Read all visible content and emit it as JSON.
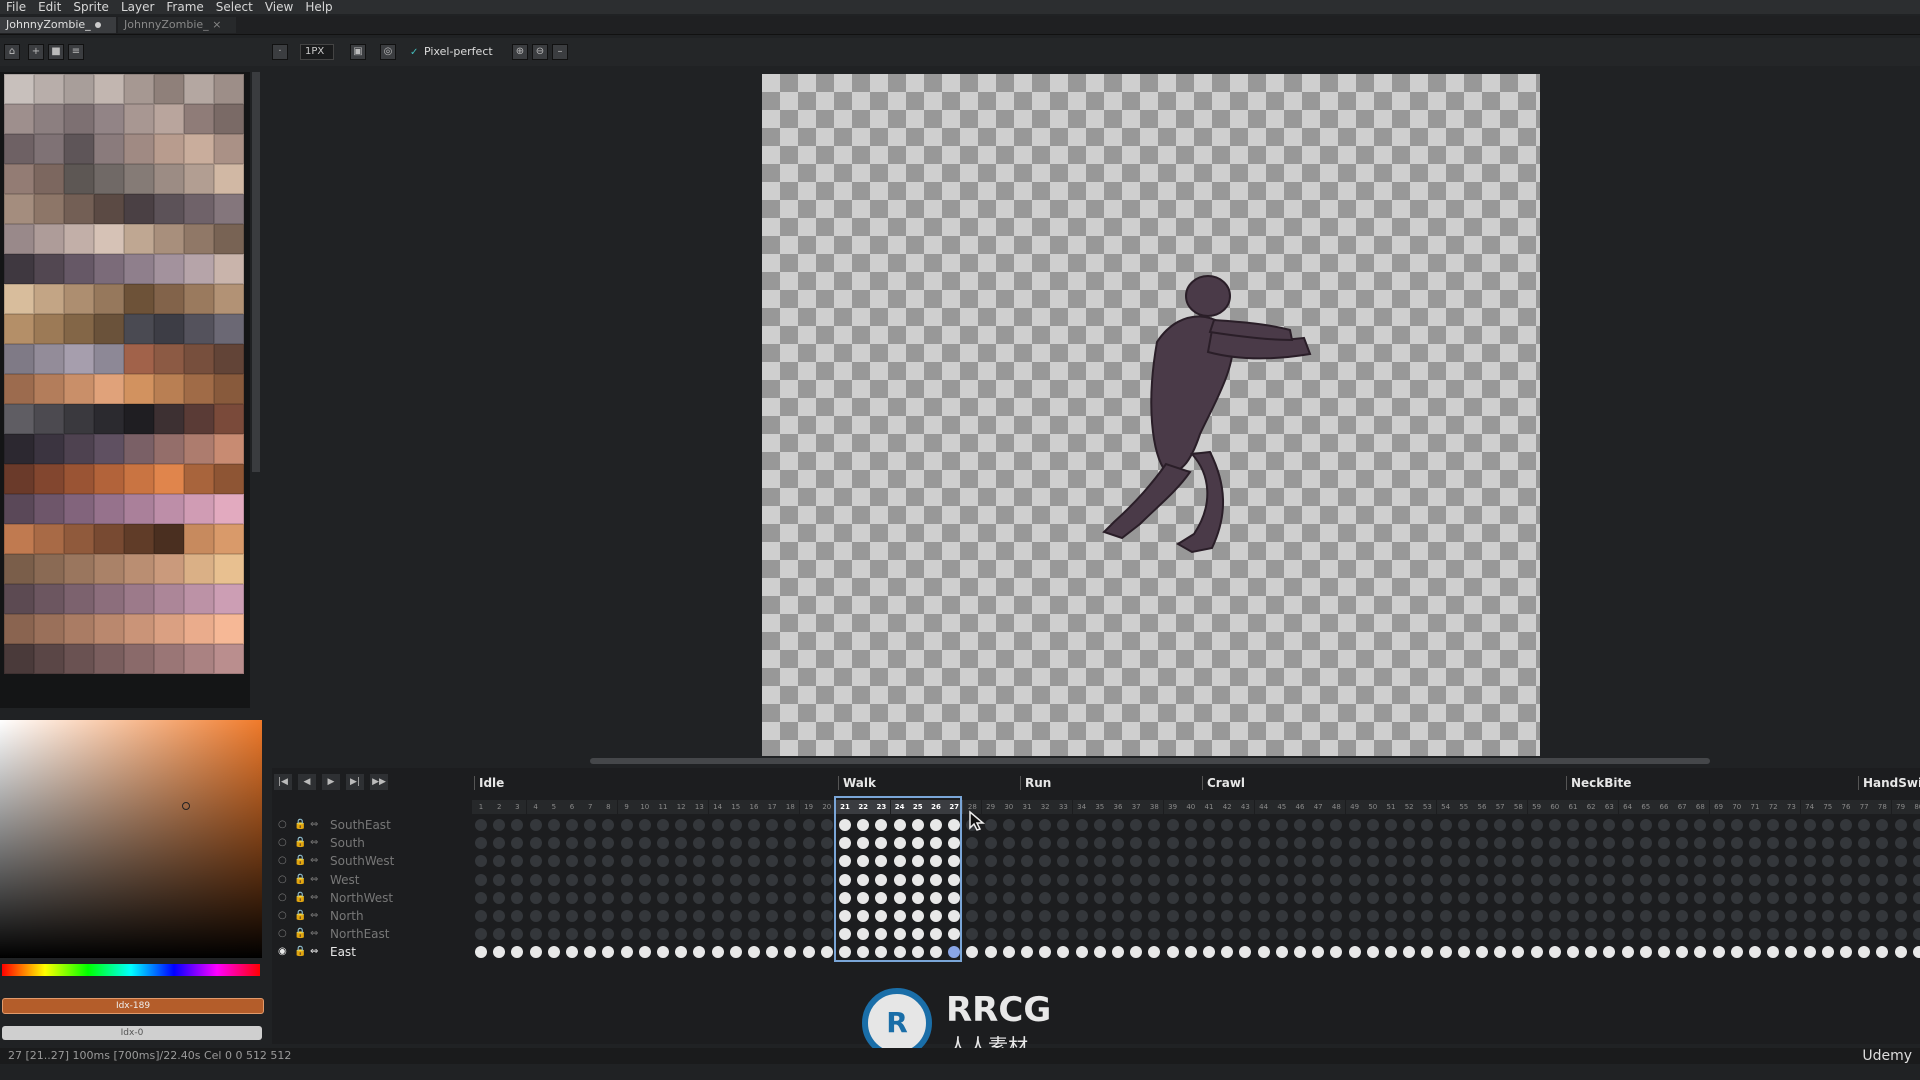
{
  "menu": [
    "File",
    "Edit",
    "Sprite",
    "Layer",
    "Frame",
    "Select",
    "View",
    "Help"
  ],
  "tabs": [
    {
      "label": "JohnnyZombie_",
      "modified": true
    },
    {
      "label": "JohnnyZombie_",
      "closable": true
    }
  ],
  "toolbar": {
    "brush_size": "1PX",
    "pixel_perfect_label": "Pixel-perfect",
    "pixel_perfect_checked": true
  },
  "palette_colors": [
    "#c8c0bc",
    "#b8aeaa",
    "#a89e9a",
    "#c2b6b0",
    "#a69892",
    "#8f807a",
    "#b4a7a1",
    "#9d8e88",
    "#9e8f8d",
    "#8c7f80",
    "#7d7072",
    "#928486",
    "#a89792",
    "#b9a59d",
    "#8f7c78",
    "#7a6a66",
    "#6e6164",
    "#7f7275",
    "#5e5558",
    "#8a7b7c",
    "#a08a83",
    "#b89c8e",
    "#c9ad9c",
    "#aa9186",
    "#937c74",
    "#7c675f",
    "#5d5754",
    "#706966",
    "#857b76",
    "#9c8c84",
    "#b29e92",
    "#d1b8a4",
    "#a48d7e",
    "#8d7668",
    "#735f55",
    "#5b4a44",
    "#4a4044",
    "#5c5258",
    "#6f6269",
    "#84767c",
    "#99898a",
    "#ae9c99",
    "#c2afa8",
    "#d6c2b6",
    "#bfa792",
    "#a88f7c",
    "#907867",
    "#786354",
    "#3f3840",
    "#524751",
    "#665866",
    "#7b6b79",
    "#8f7f8c",
    "#a3929d",
    "#b6a4a9",
    "#c9b4ab",
    "#d8bd9c",
    "#c3a585",
    "#ad8e70",
    "#96785c",
    "#6d5238",
    "#82634a",
    "#9a7a5e",
    "#b29275",
    "#b48f68",
    "#9c7a56",
    "#836647",
    "#6a523a",
    "#4a4a52",
    "#3d3d45",
    "#54525c",
    "#6b6874",
    "#7f7a86",
    "#938c99",
    "#a69ead",
    "#8d8896",
    "#a1624a",
    "#8c5a44",
    "#774f3d",
    "#624437",
    "#9c6b4e",
    "#b37d5b",
    "#c98f69",
    "#e0a27a",
    "#d2925f",
    "#b97f53",
    "#a06b47",
    "#885a3c",
    "#5f5d63",
    "#4c4a50",
    "#3a393e",
    "#2b2a2f",
    "#1f1e22",
    "#3d3032",
    "#5a3b36",
    "#7a4a3a",
    "#2c2830",
    "#3b3440",
    "#4e4250",
    "#5f5061",
    "#7a6066",
    "#946e6a",
    "#ad7c6e",
    "#c88b72",
    "#6a3a2a",
    "#82462f",
    "#9a5434",
    "#b2633a",
    "#c97442",
    "#e0854c",
    "#a8643c",
    "#8e5534",
    "#5a4858",
    "#6e566a",
    "#82647c",
    "#96728c",
    "#aa809a",
    "#bd8ea8",
    "#d09cb4",
    "#e2aabf",
    "#c07a50",
    "#a86a46",
    "#905a3c",
    "#784a32",
    "#603c28",
    "#4a2f20",
    "#c78a5e",
    "#d99a6a",
    "#7a5e4a",
    "#8a6a54",
    "#9a765e",
    "#aa8268",
    "#ba8e72",
    "#ca9a7c",
    "#dab086",
    "#e8c090",
    "#5c4a52",
    "#6c5660",
    "#7c626e",
    "#8c6e7c",
    "#9c7a8a",
    "#ac8698",
    "#bc92a6",
    "#cc9eb4",
    "#8a6450",
    "#9a705a",
    "#aa7c64",
    "#ba886e",
    "#ca9478",
    "#daa082",
    "#eaac8c",
    "#f6b896",
    "#4a3a3a",
    "#5a4646",
    "#6a5252",
    "#7a5e5e",
    "#8a6a6a",
    "#9a7676",
    "#aa8282",
    "#ba8e8e"
  ],
  "color_index_label": "Idx-189",
  "alpha_index_label": "Idx-0",
  "timeline": {
    "tags": [
      {
        "label": "Idle"
      },
      {
        "label": "Walk"
      },
      {
        "label": "Run"
      },
      {
        "label": "Crawl"
      },
      {
        "label": "NeckBite"
      },
      {
        "label": "HandSwin"
      }
    ],
    "frame_count": 80,
    "selected_range": [
      21,
      27
    ],
    "current_frame": 27,
    "layers": [
      {
        "name": "SouthEast",
        "visible": false
      },
      {
        "name": "South",
        "visible": false
      },
      {
        "name": "SouthWest",
        "visible": false
      },
      {
        "name": "West",
        "visible": false
      },
      {
        "name": "NorthWest",
        "visible": false
      },
      {
        "name": "North",
        "visible": false
      },
      {
        "name": "NorthEast",
        "visible": false
      },
      {
        "name": "East",
        "visible": true,
        "active": true
      }
    ],
    "play_buttons": [
      "first-frame-icon",
      "prev-frame-icon",
      "play-icon",
      "next-frame-icon",
      "last-frame-icon"
    ]
  },
  "status": {
    "text": "27 [21..27]  100ms [700ms]/22.40s  Cel  0 0  512 512",
    "udemy": "Udemy"
  },
  "watermark": {
    "title": "RRCG",
    "subtitle": "人人素材"
  },
  "colors": {
    "accent": "#7aa6d8",
    "fg_color": "#b45d2a"
  }
}
